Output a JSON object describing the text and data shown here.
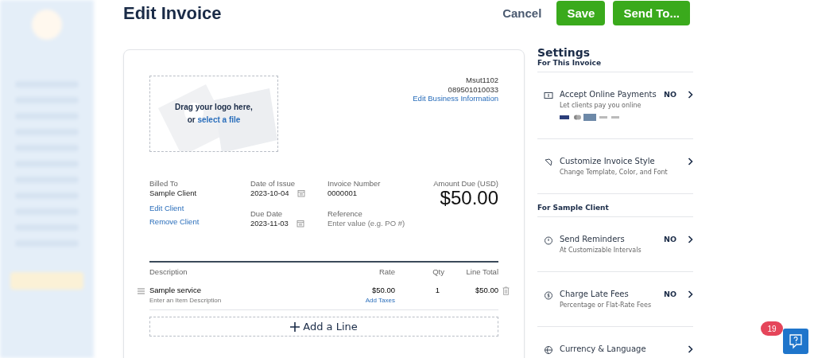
{
  "header": {
    "title": "Edit Invoice",
    "buttons": [
      {
        "label": "Cancel",
        "kind": "secondary"
      },
      {
        "label": "Save",
        "kind": "primary"
      },
      {
        "label": "Send To...",
        "kind": "primary"
      }
    ]
  },
  "invoice": {
    "logo_upload": {
      "text": "Drag your logo here,",
      "prefix": "or",
      "link": "select a file"
    },
    "business": {
      "name": "Msut1102",
      "phone": "089501010033",
      "link": "Edit Business Information"
    },
    "billed_to": {
      "label": "Billed To",
      "value": "Sample Client",
      "links": [
        "Edit Client",
        "Remove Client"
      ]
    },
    "fields": [
      {
        "label": "Date of Issue",
        "value": "2023-10-04",
        "kind": "date"
      },
      {
        "label": "Invoice Number",
        "value": "0000001",
        "kind": "text"
      },
      {
        "label": "Due Date",
        "value": "2023-11-03",
        "kind": "date"
      },
      {
        "label": "Reference",
        "placeholder": "Enter value (e.g. PO #)",
        "kind": "input"
      }
    ],
    "amount": {
      "label": "Amount Due (USD)",
      "value": "$50.00"
    },
    "line_items": {
      "columns": [
        "Description",
        "Rate",
        "Qty",
        "Line Total"
      ],
      "rows": [
        {
          "description": "Sample service",
          "note": "Enter an Item Description",
          "rate": "$50.00",
          "tax_link": "Add Taxes",
          "qty": "1",
          "total": "$50.00"
        }
      ]
    },
    "add_line": "Add a Line"
  },
  "settings": {
    "title": "Settings",
    "sections": [
      {
        "heading": "For This Invoice",
        "items": [
          {
            "kind": "payments",
            "title": "Accept Online Payments",
            "subtitle": "Let clients pay you online",
            "status": "NO"
          },
          {
            "kind": "style",
            "title": "Customize Invoice Style",
            "subtitle": "Change Template, Color, and Font"
          }
        ]
      },
      {
        "heading": "For Sample Client",
        "items": [
          {
            "kind": "reminders",
            "title": "Send Reminders",
            "subtitle": "At Customizable Intervals",
            "status": "NO"
          },
          {
            "kind": "fees",
            "title": "Charge Late Fees",
            "subtitle": "Percentage or Flat-Rate Fees",
            "status": "NO"
          },
          {
            "kind": "currency",
            "title": "Currency & Language"
          }
        ]
      }
    ]
  },
  "help_widget": {
    "badge": "19"
  }
}
